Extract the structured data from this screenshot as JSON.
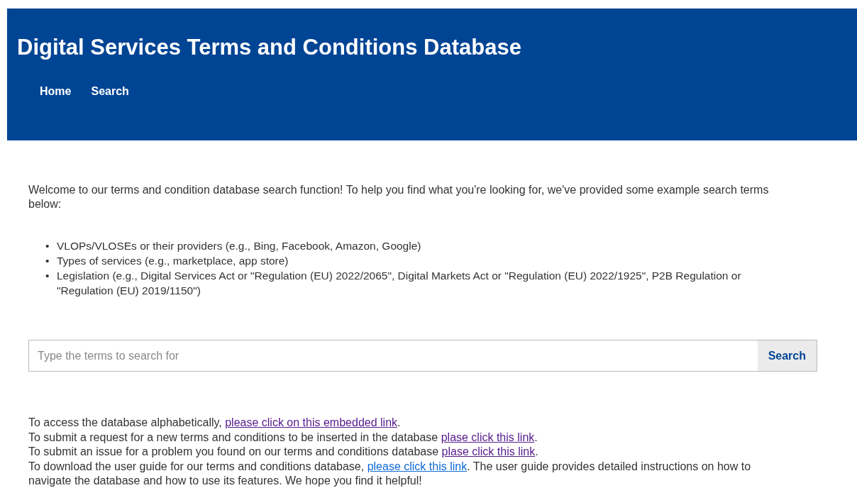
{
  "header": {
    "title": "Digital Services Terms and Conditions Database",
    "nav": [
      {
        "label": "Home"
      },
      {
        "label": "Search"
      }
    ]
  },
  "intro": "Welcome to our terms and condition database search function! To help you find what you're looking for, we've provided some example search terms below:",
  "examples": [
    {
      "marker": "•",
      "text": "VLOPs/VLOSEs or their providers (e.g., Bing, Facebook, Amazon, Google)"
    },
    {
      "marker": "•",
      "text": "Types of services (e.g., marketplace, app store)"
    },
    {
      "marker": "•",
      "text": "Legislation (e.g., Digital Services Act or \"Regulation (EU) 2022/2065\", Digital Markets Act or \"Regulation (EU) 2022/1925\", P2B Regulation or \"Regulation (EU) 2019/1150\")"
    }
  ],
  "search": {
    "placeholder": "Type the terms to search for",
    "button": "Search"
  },
  "links": [
    {
      "before": "To access the database alphabetically,",
      "link": "please click on this embedded link",
      "visited": true,
      "after": "."
    },
    {
      "before": "To submit a request for a new terms and conditions to be inserted in the database",
      "link": "plase click this link",
      "visited": true,
      "after": "."
    },
    {
      "before": "To submit an issue for a problem you found on our terms and conditions database",
      "link": "plase click this link",
      "visited": true,
      "after": "."
    },
    {
      "before": "To download the user guide for our terms and conditions database,",
      "link": "please click this link",
      "visited": false,
      "after": ". The user guide provides detailed instructions on how to navigate the database and how to use its features. We hope you find it helpful!"
    }
  ]
}
